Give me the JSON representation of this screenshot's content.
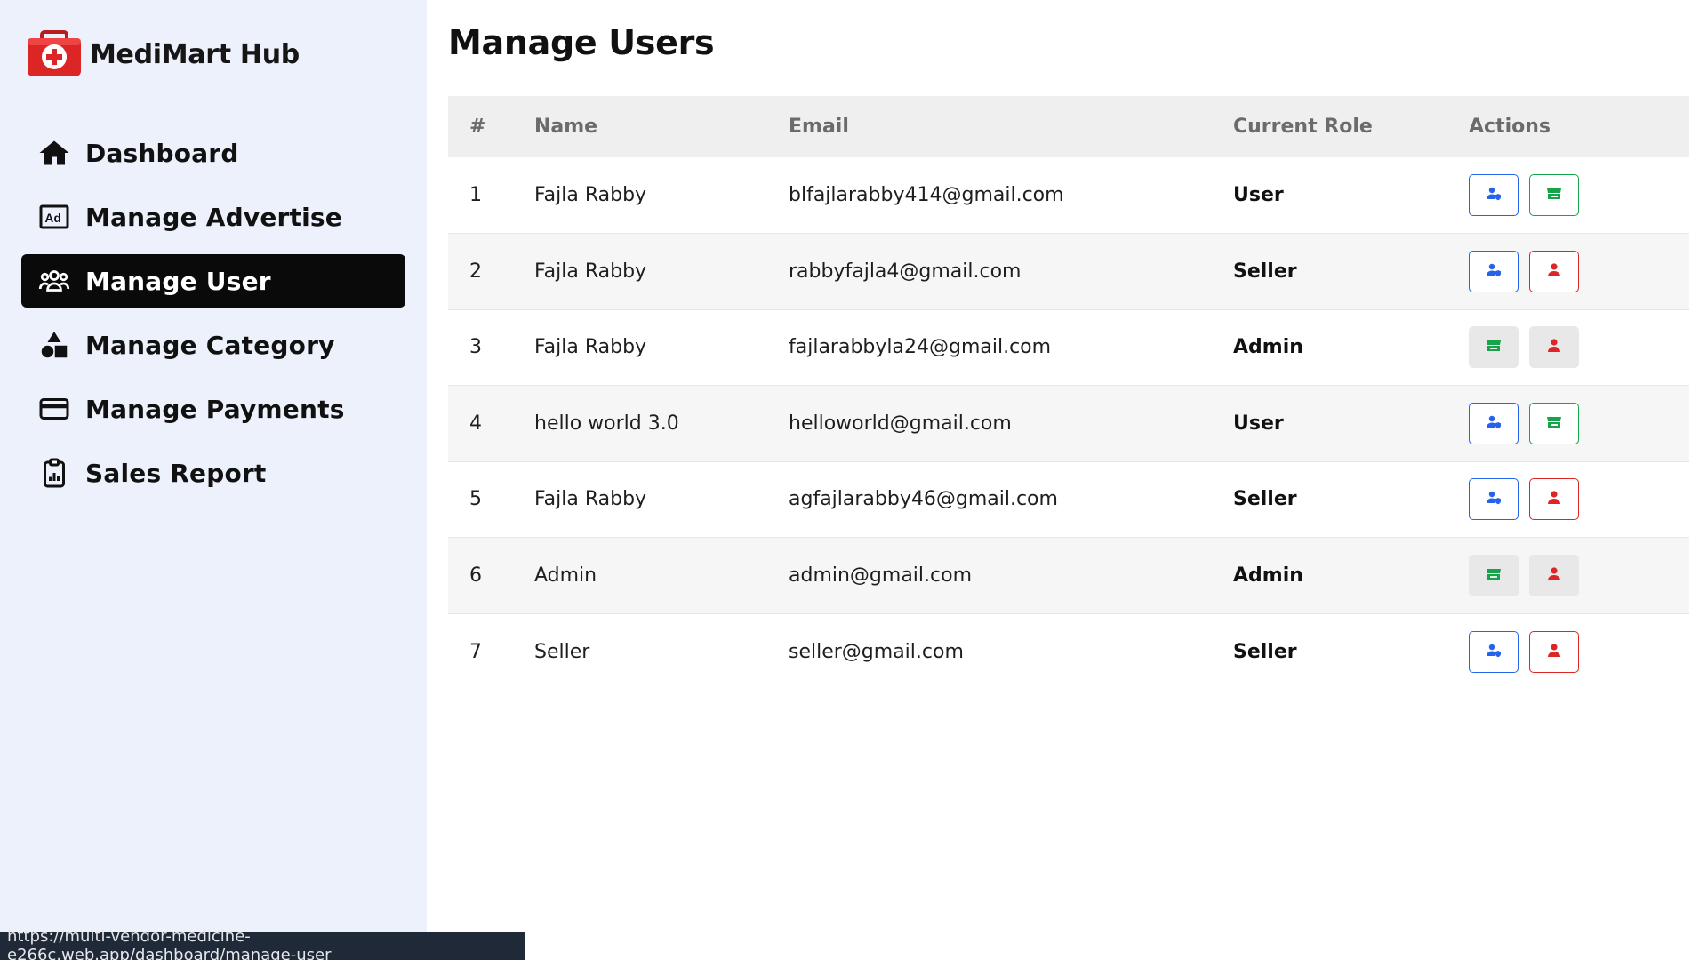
{
  "brand": {
    "name": "MediMart Hub",
    "logo_icon": "medical-kit-icon",
    "color": "#dc2626"
  },
  "sidebar": {
    "items": [
      {
        "label": "Dashboard",
        "icon": "home-icon",
        "active": false
      },
      {
        "label": "Manage Advertise",
        "icon": "ad-icon",
        "active": false
      },
      {
        "label": "Manage User",
        "icon": "users-icon",
        "active": true
      },
      {
        "label": "Manage Category",
        "icon": "shapes-icon",
        "active": false
      },
      {
        "label": "Manage Payments",
        "icon": "credit-card-icon",
        "active": false
      },
      {
        "label": "Sales Report",
        "icon": "clipboard-report-icon",
        "active": false
      }
    ]
  },
  "main": {
    "title": "Manage Users",
    "table": {
      "headers": [
        "#",
        "Name",
        "Email",
        "Current Role",
        "Actions"
      ],
      "rows": [
        {
          "num": "1",
          "name": "Fajla Rabby",
          "email": "blfajlarabby414@gmail.com",
          "role": "User"
        },
        {
          "num": "2",
          "name": "Fajla Rabby",
          "email": "rabbyfajla4@gmail.com",
          "role": "Seller"
        },
        {
          "num": "3",
          "name": "Fajla Rabby",
          "email": "fajlarabbyla24@gmail.com",
          "role": "Admin"
        },
        {
          "num": "4",
          "name": "hello world 3.0",
          "email": "helloworld@gmail.com",
          "role": "User"
        },
        {
          "num": "5",
          "name": "Fajla Rabby",
          "email": "agfajlarabby46@gmail.com",
          "role": "Seller"
        },
        {
          "num": "6",
          "name": "Admin",
          "email": "admin@gmail.com",
          "role": "Admin"
        },
        {
          "num": "7",
          "name": "Seller",
          "email": "seller@gmail.com",
          "role": "Seller"
        }
      ]
    }
  },
  "status_bar": {
    "url": "https://multi-vendor-medicine-e266c.web.app/dashboard/manage-user"
  },
  "colors": {
    "blue": "#2563eb",
    "green": "#16a34a",
    "red": "#dc2626",
    "sidebar_bg": "#edf1fb",
    "active_bg": "#0a0a0a"
  }
}
